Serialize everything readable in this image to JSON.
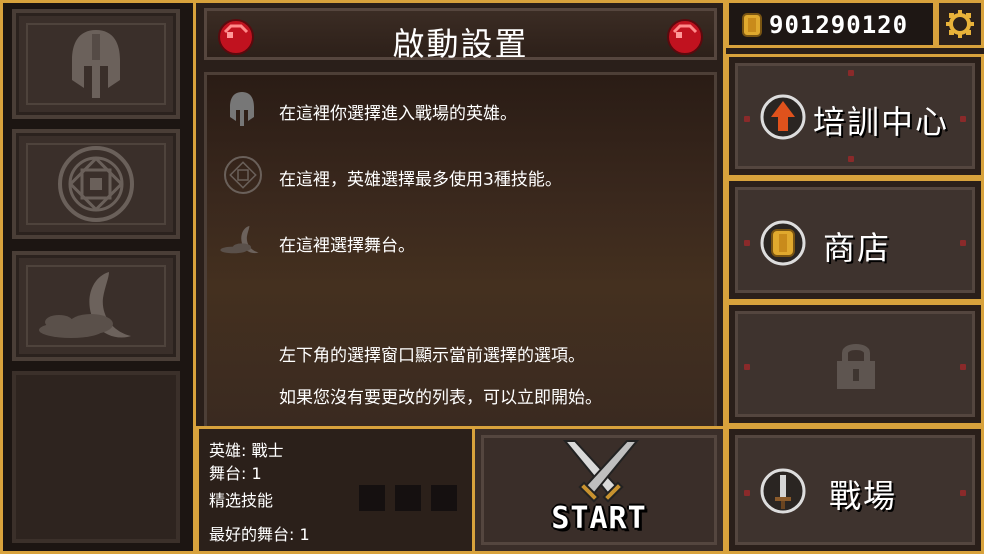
{
  "title": "啟動設置",
  "coins": "901290120",
  "info": {
    "hero_hint": "在這裡你選擇進入戰場的英雄。",
    "skill_hint": "在這裡，英雄選擇最多使用3種技能。",
    "stage_hint": "在這裡選擇舞台。",
    "window_hint": "左下角的選擇窗口顯示當前選擇的選項。",
    "start_hint": "如果您沒有要更改的列表，可以立即開始。"
  },
  "status": {
    "hero": "英雄: 戰士",
    "stage": "舞台: 1",
    "skills_label": "精选技能",
    "best_stage": "最好的舞台: 1"
  },
  "start_label": "START",
  "menu": {
    "training": "培訓中心",
    "shop": "商店",
    "battlefield": "戰場"
  },
  "colors": {
    "accent_gold": "#d8a23c",
    "gem_red": "#d01f2a",
    "panel_dark": "#2a1f1a"
  },
  "icons": [
    "helmet-icon",
    "rune-circle-icon",
    "moon-cloud-icon",
    "gem-icon",
    "coin-icon",
    "gear-icon",
    "upgrade-arrow-icon",
    "lock-icon",
    "sword-icon",
    "crossed-swords-icon"
  ]
}
